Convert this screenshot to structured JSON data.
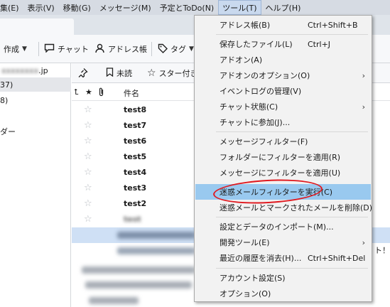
{
  "menubar": {
    "items": [
      "編集(E)",
      "表示(V)",
      "移動(G)",
      "メッセージ(M)",
      "予定とToDo(N)",
      "ツール(T)",
      "ヘルプ(H)"
    ],
    "first_visible_fragment": "集(E)",
    "active_index": 5
  },
  "toolbar": {
    "compose": "作成",
    "chat": "チャット",
    "address_book": "アドレス帳",
    "tag": "タグ"
  },
  "folders": {
    "account_suffix": ".jp",
    "account_blurred": "xxxxxxxx",
    "inbox_count": "37)",
    "item2_count": "8)",
    "item3": "ダー"
  },
  "quickfilter": {
    "unread": "未読",
    "starred": "スター付き"
  },
  "columns": {
    "subject": "件名"
  },
  "messages": [
    {
      "subject": "test8"
    },
    {
      "subject": "test7"
    },
    {
      "subject": "test6"
    },
    {
      "subject": "test5"
    },
    {
      "subject": "test4"
    },
    {
      "subject": "test3"
    },
    {
      "subject": "test2"
    },
    {
      "subject": "test"
    }
  ],
  "right_fragment": "ト！",
  "tools_menu": {
    "items": [
      {
        "label": "アドレス帳(B)",
        "shortcut": "Ctrl+Shift+B",
        "arrow": ""
      },
      {
        "label": "保存したファイル(L)",
        "shortcut": "Ctrl+J",
        "arrow": ""
      },
      {
        "label": "アドオン(A)",
        "shortcut": "",
        "arrow": ""
      },
      {
        "label": "アドオンのオプション(O)",
        "shortcut": "",
        "arrow": "›"
      },
      {
        "label": "イベントログの管理(V)",
        "shortcut": "",
        "arrow": ""
      },
      {
        "label": "チャット状態(C)",
        "shortcut": "",
        "arrow": "›"
      },
      {
        "label": "チャットに参加(J)...",
        "shortcut": "",
        "arrow": ""
      },
      {
        "label": "メッセージフィルター(F)",
        "shortcut": "",
        "arrow": ""
      },
      {
        "label": "フォルダーにフィルターを適用(R)",
        "shortcut": "",
        "arrow": ""
      },
      {
        "label": "メッセージにフィルターを適用(U)",
        "shortcut": "",
        "arrow": ""
      },
      {
        "label": "迷惑メールフィルターを実行(C)",
        "shortcut": "",
        "arrow": ""
      },
      {
        "label": "迷惑メールとマークされたメールを削除(D)",
        "shortcut": "",
        "arrow": ""
      },
      {
        "label": "設定とデータのインポート(M)...",
        "shortcut": "",
        "arrow": ""
      },
      {
        "label": "開発ツール(E)",
        "shortcut": "",
        "arrow": "›"
      },
      {
        "label": "最近の履歴を消去(H)...",
        "shortcut": "Ctrl+Shift+Del",
        "arrow": ""
      },
      {
        "label": "アカウント設定(S)",
        "shortcut": "",
        "arrow": ""
      },
      {
        "label": "オプション(O)",
        "shortcut": "",
        "arrow": ""
      }
    ],
    "highlighted_index": 10
  },
  "colors": {
    "menu_highlight": "#99c9ef",
    "annotation_circle": "#e0191f",
    "menubar_bg": "#d6dbe3"
  }
}
